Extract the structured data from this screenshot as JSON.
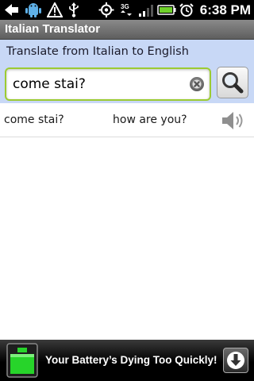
{
  "status_bar": {
    "time": "6:38 PM",
    "icons": [
      "back-icon",
      "android-icon",
      "warning-icon",
      "usb-icon",
      "gps-icon",
      "3g-icon",
      "signal-icon",
      "battery-icon",
      "alarm-icon"
    ]
  },
  "app": {
    "title": "Italian Translator"
  },
  "translator": {
    "direction_label": "Translate from Italian to English",
    "input_value": "come stai?",
    "clear_icon": "clear-icon",
    "search_icon": "search-icon"
  },
  "results": [
    {
      "source": "come stai?",
      "translation": "how are you?",
      "icon": "speaker-icon"
    }
  ],
  "ad": {
    "text": "Your Battery’s Dying Too Quickly!",
    "icons": [
      "battery-icon",
      "download-icon"
    ]
  },
  "colors": {
    "panel_bg": "#c8d8f6",
    "input_border": "#9ccb32",
    "battery_green": "#27d42a"
  }
}
